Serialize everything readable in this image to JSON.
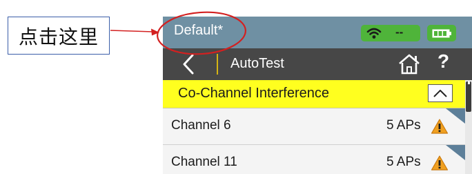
{
  "annotation": {
    "callout_text": "点击这里",
    "border_color": "#3a5da8",
    "arrow_color": "#d32020",
    "highlight_color": "#d32020"
  },
  "status_bar": {
    "profile_name": "Default*",
    "wifi_status": "--",
    "wifi_icon": "wifi-icon",
    "battery_icon": "battery-icon",
    "badge_color": "#4fb43a"
  },
  "title_bar": {
    "back_icon": "chevron-left-icon",
    "title": "AutoTest",
    "home_icon": "home-icon",
    "help_label": "?"
  },
  "section": {
    "title": "Co-Channel Interference",
    "collapse_icon": "chevron-up-icon",
    "header_color": "#ffff1f"
  },
  "channels": [
    {
      "name": "Channel 6",
      "ap_count": "5 APs",
      "status_icon": "warning-icon"
    },
    {
      "name": "Channel 11",
      "ap_count": "5 APs",
      "status_icon": "warning-icon"
    }
  ],
  "colors": {
    "status_bar": "#6f90a3",
    "title_bar": "#474747",
    "warning": "#f0a020"
  }
}
